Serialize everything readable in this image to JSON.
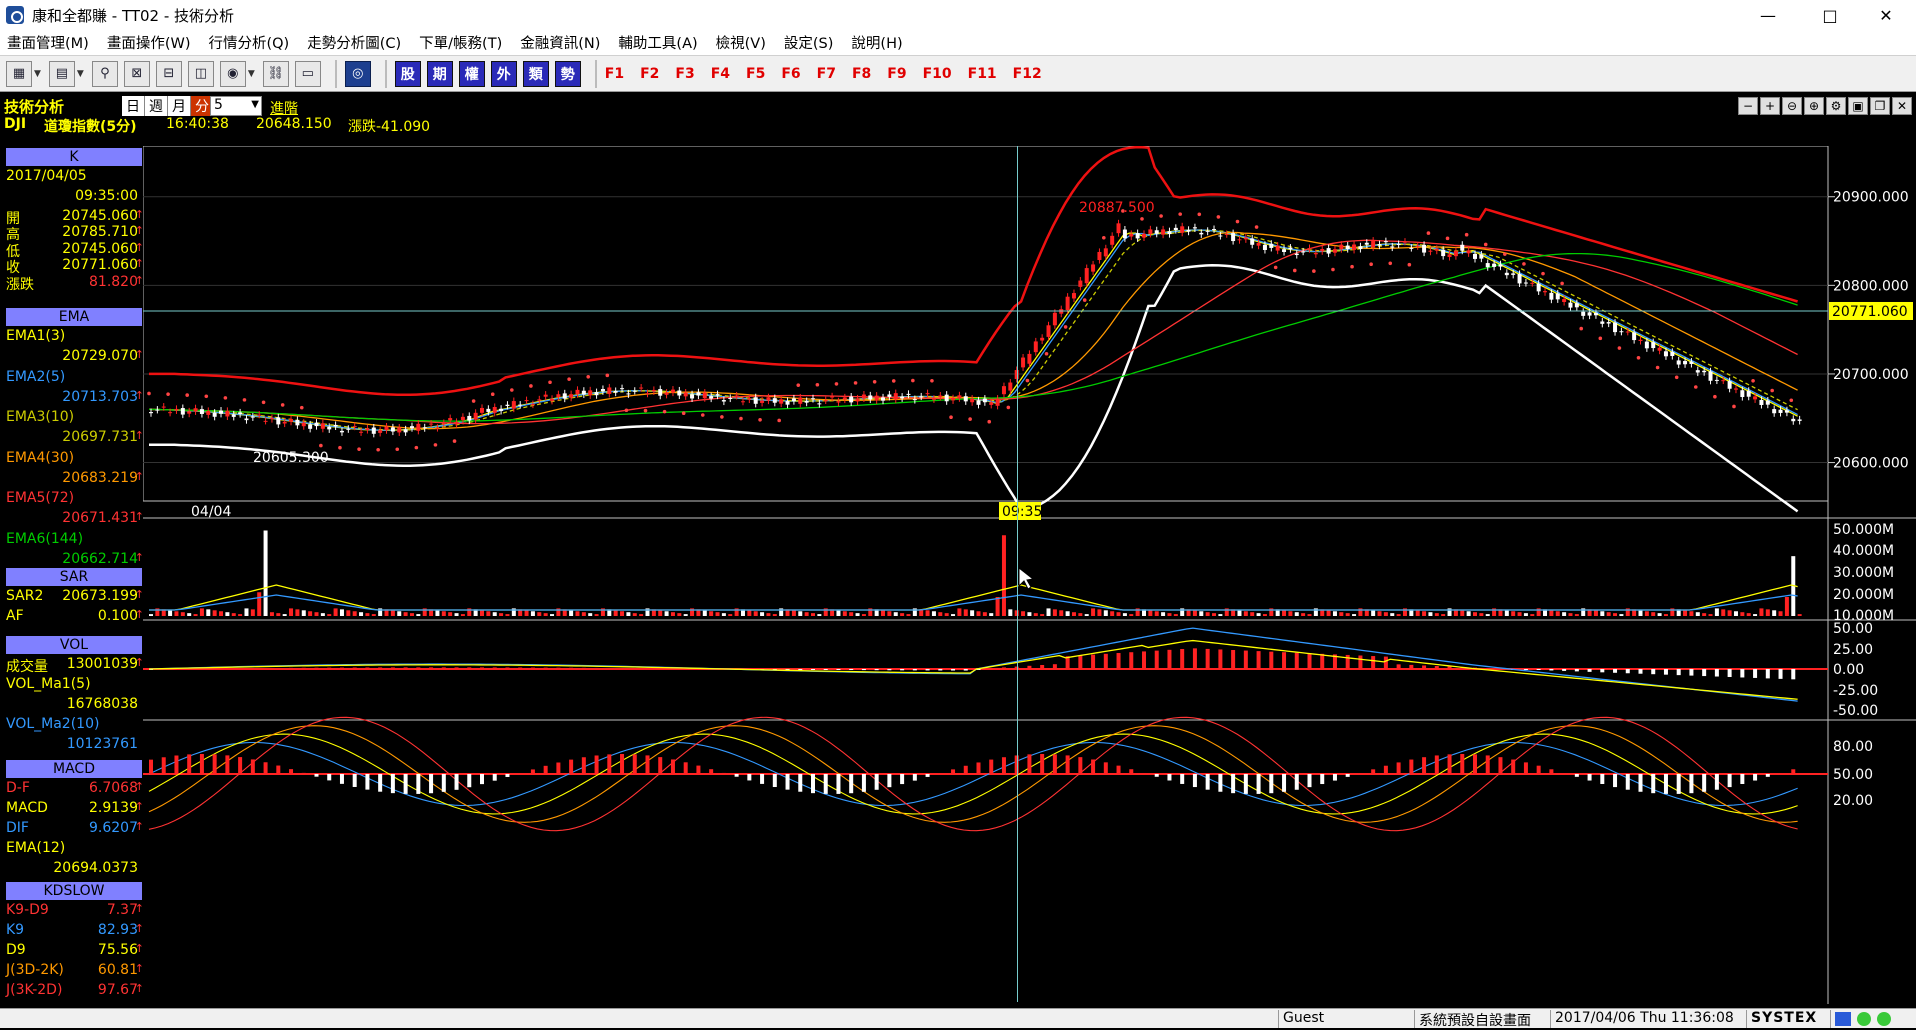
{
  "window": {
    "title": "康和全都賺 - TT02 - 技術分析",
    "minimize": "—",
    "maximize": "□",
    "close": "✕"
  },
  "menu": [
    "畫面管理(M)",
    "畫面操作(W)",
    "行情分析(Q)",
    "走勢分析圖(C)",
    "下單/帳務(T)",
    "金融資訊(N)",
    "輔助工具(A)",
    "檢視(V)",
    "設定(S)",
    "說明(H)"
  ],
  "toolbar": {
    "quote_buttons": [
      "股",
      "期",
      "權",
      "外",
      "類",
      "勢"
    ],
    "fkeys": [
      "F1",
      "F2",
      "F3",
      "F4",
      "F5",
      "F6",
      "F7",
      "F8",
      "F9",
      "F10",
      "F11",
      "F12"
    ]
  },
  "info": {
    "title": "技術分析",
    "symbol": "DJI",
    "name": "道瓊指數(5分)",
    "time": "16:40:38",
    "price": "20648.150",
    "change": "漲跌-41.090",
    "periods": [
      "日",
      "週",
      "月",
      "分"
    ],
    "selected_period": "分",
    "interval": "5",
    "advanced": "進階"
  },
  "left": {
    "k": {
      "header": "K",
      "date": "2017/04/05",
      "time": "09:35:00",
      "rows": [
        {
          "label": "開",
          "value": "20745.060"
        },
        {
          "label": "高",
          "value": "20785.710"
        },
        {
          "label": "低",
          "value": "20745.060"
        },
        {
          "label": "收",
          "value": "20771.060"
        },
        {
          "label": "漲跌",
          "value": "81.820"
        }
      ]
    },
    "ema": {
      "header": "EMA",
      "items": [
        {
          "label": "EMA1(3)",
          "value": "20729.070",
          "color": "#ffff00"
        },
        {
          "label": "EMA2(5)",
          "value": "20713.703",
          "color": "#3399ff"
        },
        {
          "label": "EMA3(10)",
          "value": "20697.731",
          "color": "#cccc00"
        },
        {
          "label": "EMA4(30)",
          "value": "20683.219",
          "color": "#ff9900"
        },
        {
          "label": "EMA5(72)",
          "value": "20671.431",
          "color": "#ff3333"
        },
        {
          "label": "EMA6(144)",
          "value": "20662.714",
          "color": "#00cc00"
        }
      ]
    },
    "sar": {
      "header": "SAR",
      "rows": [
        {
          "label": "SAR2",
          "value": "20673.199"
        },
        {
          "label": "AF",
          "value": "0.100"
        }
      ]
    },
    "vol": {
      "header": "VOL",
      "rows": [
        {
          "label": "成交量",
          "value": "13001039"
        },
        {
          "label": "VOL_Ma1(5)",
          "value": "16768038"
        },
        {
          "label": "VOL_Ma2(10)",
          "value": "10123761"
        }
      ]
    },
    "macd": {
      "header": "MACD",
      "rows": [
        {
          "label": "D-F",
          "value": "6.7068"
        },
        {
          "label": "MACD",
          "value": "2.9139"
        },
        {
          "label": "DIF",
          "value": "9.6207"
        },
        {
          "label": "EMA(12)",
          "value": "20694.0373"
        }
      ]
    },
    "kd": {
      "header": "KDSLOW",
      "rows": [
        {
          "label": "K9-D9",
          "value": "7.37"
        },
        {
          "label": "K9",
          "value": "82.93"
        },
        {
          "label": "D9",
          "value": "75.56"
        },
        {
          "label": "J(3D-2K)",
          "value": "60.81"
        },
        {
          "label": "J(3K-2D)",
          "value": "97.67"
        }
      ]
    }
  },
  "chart_data": {
    "type": "candlestick",
    "price_axis": {
      "ticks": [
        20900,
        20800,
        20700,
        20600
      ],
      "tick_labels": [
        "20900.000",
        "20800.000",
        "20700.000",
        "20600.000"
      ],
      "range": [
        20560,
        20955
      ]
    },
    "current_price_label": "20771.060",
    "high_annotation": "20887.500",
    "low_annotation": "20605.300",
    "x_labels": [
      "04/04",
      "09:35"
    ],
    "volume_axis": {
      "tick_labels": [
        "50.000M",
        "40.000M",
        "30.000M",
        "20.000M",
        "10.000M"
      ]
    },
    "macd_axis": {
      "tick_labels": [
        "50.00",
        "25.00",
        "0.00",
        "-25.00",
        "-50.00"
      ]
    },
    "kd_axis": {
      "tick_labels": [
        "80.00",
        "50.00",
        "20.00"
      ]
    }
  },
  "status": {
    "user": "Guest",
    "layout": "系統預設自設畫面",
    "datetime": "2017/04/06 Thu 11:36:08",
    "brand": "SYSTEX"
  }
}
